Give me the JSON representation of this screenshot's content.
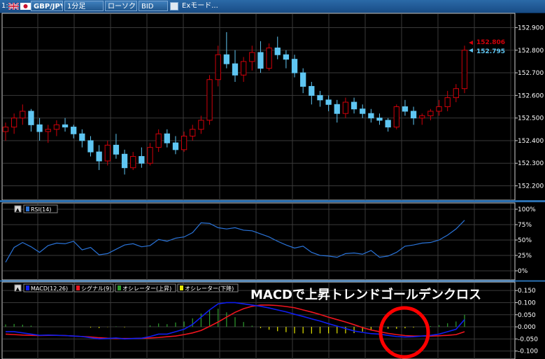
{
  "toolbar": {
    "panel_no": "1:",
    "symbol": "GBP/JPY",
    "timeframe": "1分足",
    "chart_type": "ローソク",
    "price_type": "BID",
    "ex_mode": "Exモード..."
  },
  "colors": {
    "up": "#d0000a",
    "down": "#5fc6f2",
    "rsi": "#2a73d8",
    "macd": "#0f1ef0",
    "signal": "#f0141e",
    "osc_up": "#2e9d2e",
    "osc_down": "#e6e600",
    "annotation_circle": "#ff0000"
  },
  "annotation": {
    "text": "MACDで上昇トレンドゴールデンクロス"
  },
  "chart_data": [
    {
      "type": "candlestick",
      "ylim": [
        152.18,
        152.92
      ],
      "yticks": [
        "152.900",
        "152.800",
        "152.700",
        "152.600",
        "152.500",
        "152.400",
        "152.300",
        "152.200"
      ],
      "last_ask_label": "152.806",
      "last_bid_label": "152.795",
      "ohlc": [
        [
          152.44,
          152.48,
          152.4,
          152.46
        ],
        [
          152.46,
          152.52,
          152.43,
          152.5
        ],
        [
          152.5,
          152.56,
          152.47,
          152.53
        ],
        [
          152.53,
          152.54,
          152.44,
          152.47
        ],
        [
          152.47,
          152.5,
          152.4,
          152.44
        ],
        [
          152.44,
          152.47,
          152.39,
          152.45
        ],
        [
          152.45,
          152.49,
          152.42,
          152.47
        ],
        [
          152.47,
          152.5,
          152.44,
          152.46
        ],
        [
          152.46,
          152.47,
          152.41,
          152.43
        ],
        [
          152.43,
          152.45,
          152.37,
          152.4
        ],
        [
          152.4,
          152.42,
          152.33,
          152.35
        ],
        [
          152.35,
          152.38,
          152.27,
          152.31
        ],
        [
          152.31,
          152.4,
          152.29,
          152.38
        ],
        [
          152.38,
          152.43,
          152.32,
          152.34
        ],
        [
          152.34,
          152.36,
          152.25,
          152.28
        ],
        [
          152.28,
          152.35,
          152.27,
          152.33
        ],
        [
          152.33,
          152.37,
          152.28,
          152.3
        ],
        [
          152.3,
          152.39,
          152.29,
          152.37
        ],
        [
          152.37,
          152.45,
          152.35,
          152.43
        ],
        [
          152.43,
          152.45,
          152.37,
          152.39
        ],
        [
          152.39,
          152.42,
          152.34,
          152.36
        ],
        [
          152.36,
          152.44,
          152.35,
          152.42
        ],
        [
          152.42,
          152.47,
          152.4,
          152.45
        ],
        [
          152.45,
          152.51,
          152.43,
          152.49
        ],
        [
          152.49,
          152.69,
          152.47,
          152.67
        ],
        [
          152.67,
          152.82,
          152.64,
          152.78
        ],
        [
          152.78,
          152.88,
          152.72,
          152.74
        ],
        [
          152.74,
          152.8,
          152.66,
          152.69
        ],
        [
          152.69,
          152.77,
          152.66,
          152.75
        ],
        [
          152.75,
          152.82,
          152.71,
          152.79
        ],
        [
          152.79,
          152.84,
          152.7,
          152.72
        ],
        [
          152.72,
          152.83,
          152.71,
          152.81
        ],
        [
          152.81,
          152.86,
          152.76,
          152.78
        ],
        [
          152.78,
          152.8,
          152.72,
          152.76
        ],
        [
          152.76,
          152.78,
          152.68,
          152.7
        ],
        [
          152.7,
          152.72,
          152.61,
          152.64
        ],
        [
          152.64,
          152.66,
          152.56,
          152.6
        ],
        [
          152.6,
          152.62,
          152.55,
          152.58
        ],
        [
          152.58,
          152.6,
          152.53,
          152.56
        ],
        [
          152.56,
          152.58,
          152.48,
          152.52
        ],
        [
          152.52,
          152.59,
          152.5,
          152.57
        ],
        [
          152.57,
          152.59,
          152.52,
          152.54
        ],
        [
          152.54,
          152.56,
          152.5,
          152.52
        ],
        [
          152.52,
          152.54,
          152.48,
          152.5
        ],
        [
          152.5,
          152.52,
          152.47,
          152.49
        ],
        [
          152.49,
          152.5,
          152.44,
          152.46
        ],
        [
          152.46,
          152.56,
          152.45,
          152.55
        ],
        [
          152.55,
          152.58,
          152.51,
          152.53
        ],
        [
          152.53,
          152.55,
          152.47,
          152.5
        ],
        [
          152.5,
          152.52,
          152.47,
          152.51
        ],
        [
          152.51,
          152.54,
          152.49,
          152.53
        ],
        [
          152.53,
          152.58,
          152.51,
          152.55
        ],
        [
          152.55,
          152.62,
          152.53,
          152.59
        ],
        [
          152.59,
          152.65,
          152.57,
          152.63
        ],
        [
          152.63,
          152.82,
          152.61,
          152.8
        ]
      ]
    },
    {
      "type": "line",
      "legend": [
        "RSI(14)"
      ],
      "ylim": [
        0,
        100
      ],
      "yticks": [
        "100%",
        "75%",
        "50%",
        "25%",
        "0%"
      ],
      "values": [
        14,
        38,
        46,
        39,
        30,
        41,
        45,
        44,
        48,
        34,
        38,
        26,
        28,
        35,
        42,
        44,
        39,
        41,
        51,
        48,
        53,
        55,
        62,
        78,
        77,
        70,
        68,
        70,
        66,
        65,
        60,
        55,
        48,
        42,
        37,
        40,
        30,
        25,
        24,
        22,
        28,
        29,
        27,
        33,
        22,
        24,
        30,
        40,
        42,
        45,
        46,
        50,
        58,
        68,
        82
      ]
    },
    {
      "type": "macd",
      "legend": [
        "MACD(12,26)",
        "シグナル(9)",
        "オシレーター(上昇)",
        "オシレーター(下降)"
      ],
      "ylim": [
        -0.13,
        0.165
      ],
      "yticks": [
        "0.150",
        "0.100",
        "0.050",
        "0.000",
        "-0.050",
        "-0.100"
      ],
      "macd": [
        -0.02,
        -0.02,
        -0.025,
        -0.03,
        -0.035,
        -0.034,
        -0.035,
        -0.036,
        -0.038,
        -0.04,
        -0.045,
        -0.05,
        -0.048,
        -0.046,
        -0.05,
        -0.048,
        -0.047,
        -0.04,
        -0.03,
        -0.03,
        -0.02,
        -0.01,
        0.01,
        0.04,
        0.07,
        0.095,
        0.1,
        0.1,
        0.095,
        0.09,
        0.085,
        0.078,
        0.07,
        0.062,
        0.052,
        0.043,
        0.033,
        0.024,
        0.013,
        0.003,
        -0.007,
        -0.017,
        -0.023,
        -0.028,
        -0.03,
        -0.035,
        -0.04,
        -0.042,
        -0.041,
        -0.038,
        -0.035,
        -0.03,
        -0.02,
        -0.01,
        0.03
      ],
      "signal": [
        -0.03,
        -0.032,
        -0.034,
        -0.035,
        -0.036,
        -0.035,
        -0.035,
        -0.036,
        -0.038,
        -0.04,
        -0.042,
        -0.045,
        -0.047,
        -0.048,
        -0.048,
        -0.048,
        -0.047,
        -0.046,
        -0.044,
        -0.041,
        -0.038,
        -0.032,
        -0.025,
        -0.015,
        0.002,
        0.02,
        0.04,
        0.06,
        0.075,
        0.085,
        0.09,
        0.09,
        0.088,
        0.084,
        0.079,
        0.07,
        0.061,
        0.051,
        0.04,
        0.03,
        0.02,
        0.009,
        -0.003,
        -0.013,
        -0.02,
        -0.027,
        -0.032,
        -0.036,
        -0.038,
        -0.038,
        -0.038,
        -0.037,
        -0.035,
        -0.032,
        -0.02
      ],
      "osc_up": [
        0.01,
        0.012,
        0.009,
        0.005,
        0.001,
        0,
        0,
        0,
        0,
        0,
        0,
        0,
        0,
        0.002,
        0,
        0,
        0,
        0.006,
        0.014,
        0.011,
        0.018,
        0.022,
        0.035,
        0.055,
        0.068,
        0.075,
        0.06,
        0.04,
        0.02,
        0.005,
        0,
        0,
        0,
        0,
        0,
        0,
        0,
        0,
        0,
        0,
        0,
        0,
        0,
        0,
        0,
        0,
        0,
        0,
        0,
        0,
        0.003,
        0.007,
        0.015,
        0.022,
        0.05
      ],
      "osc_down": [
        0,
        0,
        0,
        0,
        0,
        0,
        0,
        0,
        0,
        0,
        -0.003,
        -0.005,
        -0.001,
        0,
        -0.002,
        0,
        0,
        0,
        0,
        0,
        0,
        0,
        0,
        0,
        0,
        0,
        0,
        0,
        0,
        0,
        -0.005,
        -0.012,
        -0.018,
        -0.022,
        -0.027,
        -0.027,
        -0.028,
        -0.027,
        -0.027,
        -0.027,
        -0.027,
        -0.026,
        -0.02,
        -0.015,
        -0.01,
        -0.008,
        -0.008,
        -0.006,
        -0.003,
        0,
        0,
        0,
        0,
        0,
        0
      ]
    }
  ]
}
